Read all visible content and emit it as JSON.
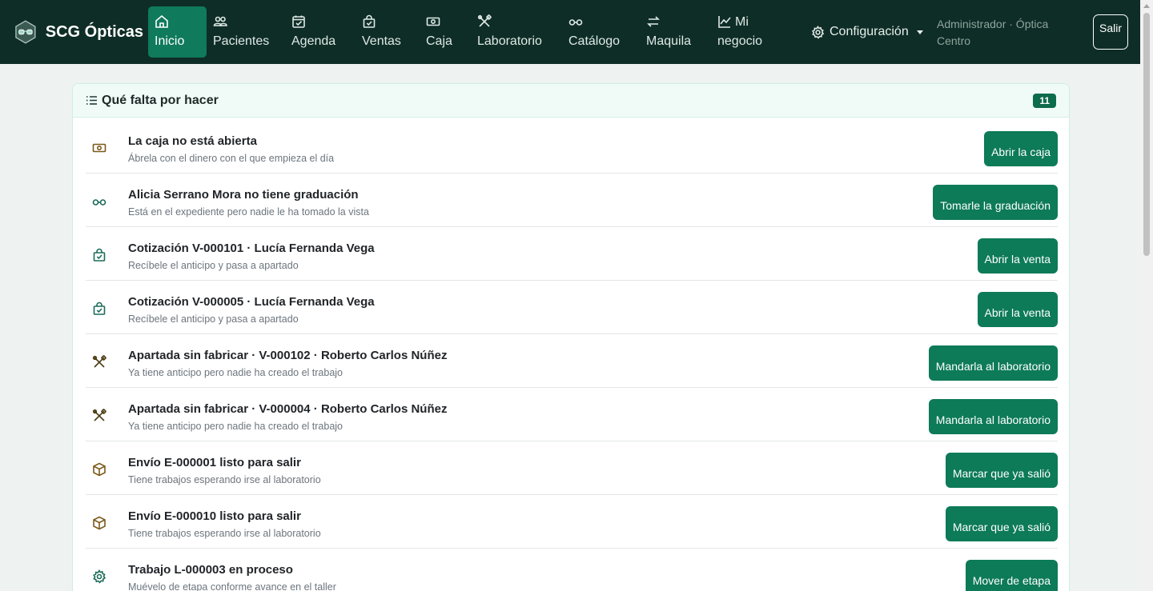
{
  "brand": {
    "name": "SCG Ópticas"
  },
  "nav": {
    "inicio": "Inicio",
    "pacientes": "Pacientes",
    "agenda": "Agenda",
    "ventas": "Ventas",
    "caja": "Caja",
    "laboratorio": "Laboratorio",
    "catalogo": "Catálogo",
    "maquila": "Maquila",
    "mi": "Mi",
    "negocio": "negocio",
    "configuracion": "Configuración"
  },
  "user": {
    "line1": "Administrador · Óptica",
    "line2": "Centro",
    "logout": "Salir"
  },
  "card": {
    "title": "Qué falta por hacer",
    "count": "11"
  },
  "tasks": [
    {
      "icon": "cash-icon",
      "title": "La caja no está abierta",
      "subtitle": "Ábrela con el dinero con el que empieza el día",
      "button": "Abrir la caja"
    },
    {
      "icon": "glasses-icon",
      "title": "Alicia Serrano Mora no tiene graduación",
      "subtitle": "Está en el expediente pero nadie le ha tomado la vista",
      "button": "Tomarle la graduación"
    },
    {
      "icon": "bag-check-icon",
      "title": "Cotización V-000101 · Lucía Fernanda Vega",
      "subtitle": "Recíbele el anticipo y pasa a apartado",
      "button": "Abrir la venta"
    },
    {
      "icon": "bag-check-icon",
      "title": "Cotización V-000005 · Lucía Fernanda Vega",
      "subtitle": "Recíbele el anticipo y pasa a apartado",
      "button": "Abrir la venta"
    },
    {
      "icon": "tools-icon",
      "title": "Apartada sin fabricar · V-000102 · Roberto Carlos Núñez",
      "subtitle": "Ya tiene anticipo pero nadie ha creado el trabajo",
      "button": "Mandarla al laboratorio"
    },
    {
      "icon": "tools-icon",
      "title": "Apartada sin fabricar · V-000004 · Roberto Carlos Núñez",
      "subtitle": "Ya tiene anticipo pero nadie ha creado el trabajo",
      "button": "Mandarla al laboratorio"
    },
    {
      "icon": "box-icon",
      "title": "Envío E-000001 listo para salir",
      "subtitle": "Tiene trabajos esperando irse al laboratorio",
      "button": "Marcar que ya salió"
    },
    {
      "icon": "box-icon",
      "title": "Envío E-000010 listo para salir",
      "subtitle": "Tiene trabajos esperando irse al laboratorio",
      "button": "Marcar que ya salió"
    },
    {
      "icon": "gear-icon",
      "title": "Trabajo L-000003 en proceso",
      "subtitle": "Muévelo de etapa conforme avance en el taller",
      "button": "Mover de etapa"
    }
  ],
  "colors": {
    "navbar": "#0e2d26",
    "accent": "#0d7a58",
    "active_nav": "#0f7a5c",
    "card_header": "#f0fbf7"
  }
}
